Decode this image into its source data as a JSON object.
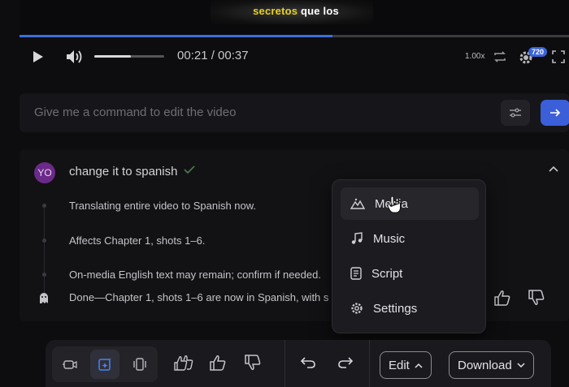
{
  "video": {
    "subtitle_word1": "secretos",
    "subtitle_rest": " que los",
    "progress": 0.57,
    "volume": 0.52,
    "current_time": "00:21",
    "duration": "00:37",
    "time_display": "00:21 / 00:37",
    "speed": "1.00x",
    "quality": "720",
    "accent": "#3a6fdc"
  },
  "command": {
    "placeholder": "Give me a command to edit the video"
  },
  "thread": {
    "avatar_initials": "YO",
    "prompt": "change it to spanish",
    "steps": [
      "Translating entire video to Spanish now.",
      "Affects Chapter 1, shots 1–6.",
      "On-media English text may remain; confirm if needed.",
      "Done—Chapter 1, shots 1–6 are now in Spanish, with s"
    ]
  },
  "menu": {
    "items": [
      {
        "label": "Media",
        "icon": "mountains-icon"
      },
      {
        "label": "Music",
        "icon": "music-note-icon"
      },
      {
        "label": "Script",
        "icon": "document-icon"
      },
      {
        "label": "Settings",
        "icon": "gear-icon"
      }
    ]
  },
  "toolbar": {
    "edit_label": "Edit",
    "download_label": "Download"
  }
}
